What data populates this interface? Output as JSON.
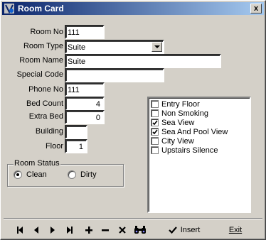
{
  "window": {
    "title": "Room Card",
    "close_symbol": "x"
  },
  "form": {
    "room_no": {
      "label": "Room No",
      "value": "111"
    },
    "room_type": {
      "label": "Room Type",
      "value": "Suite"
    },
    "room_name": {
      "label": "Room Name",
      "value": "Suite"
    },
    "special_code": {
      "label": "Special Code",
      "value": ""
    },
    "phone_no": {
      "label": "Phone No",
      "value": "111"
    },
    "bed_count": {
      "label": "Bed Count",
      "value": "4"
    },
    "extra_bed": {
      "label": "Extra Bed",
      "value": "0"
    },
    "building": {
      "label": "Building",
      "value": ""
    },
    "floor": {
      "label": "Floor",
      "value": "1"
    }
  },
  "room_status": {
    "title": "Room Status",
    "options": [
      {
        "label": "Clean",
        "selected": true
      },
      {
        "label": "Dirty",
        "selected": false
      }
    ]
  },
  "features": [
    {
      "label": "Entry Floor",
      "checked": false
    },
    {
      "label": "Non Smoking",
      "checked": false
    },
    {
      "label": "Sea View",
      "checked": true
    },
    {
      "label": "Sea And Pool View",
      "checked": true
    },
    {
      "label": "City View",
      "checked": false
    },
    {
      "label": "Upstairs Silence",
      "checked": false
    }
  ],
  "toolbar": {
    "icons": [
      "first-record-icon",
      "prior-record-icon",
      "next-record-icon",
      "last-record-icon",
      "add-icon",
      "delete-icon",
      "cancel-icon",
      "search-icon"
    ],
    "insert_label": "Insert",
    "exit_label": "Exit"
  }
}
